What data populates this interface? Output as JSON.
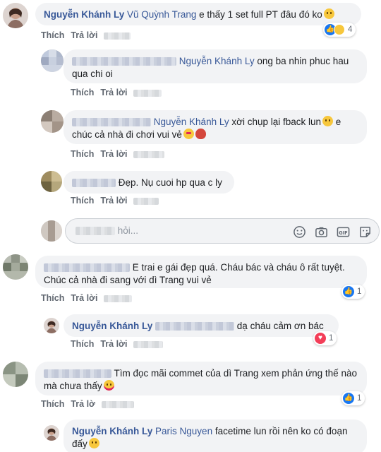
{
  "labels": {
    "like": "Thích",
    "reply": "Trả lời",
    "reply_truncated": "Trả lờ"
  },
  "colors": {
    "name": "#385898",
    "bubble": "#f2f3f5",
    "action": "#606770",
    "like_blue": "#1877f2",
    "love_red": "#f33e58"
  },
  "comments": [
    {
      "author": "Nguyễn Khánh Ly",
      "mention": "Vũ Quỳnh Trang",
      "text": "e thấy 1 set full PT đâu đó ko",
      "emoji": "laughing-tears-icon",
      "reactions": [
        "like",
        "haha"
      ],
      "reaction_count": "4"
    },
    {
      "mention": "Nguyễn Khánh Ly",
      "text": "ong ba nhin phuc hau qua chi oi"
    },
    {
      "mention": "Nguyễn Khánh Ly",
      "text_a": "xời chụp lại fback lun",
      "text_b": "e chúc cả nhà đi chơi vui vẻ",
      "emoji": [
        "laughing-tears-icon",
        "heart-eyes-icon",
        "peach-icon"
      ]
    },
    {
      "text": "Đẹp. Nụ cuoi hp qua c ly"
    },
    {
      "text": "E trai e gái đẹp quá. Cháu bác và cháu ô rất tuyệt. Chúc cả nhà đi sang với dì Trang vui vẻ",
      "reaction_count": "1"
    },
    {
      "author": "Nguyễn Khánh Ly",
      "text": "dạ cháu cảm ơn bác",
      "reaction_count": "1"
    },
    {
      "text": "Tìm đọc mãi commet của dì Trang xem phản ứng thế nào mà chưa thấy",
      "emoji": "party-face-icon",
      "reaction_count": "1"
    },
    {
      "author": "Nguyễn Khánh Ly",
      "mention": "Paris Nguyen",
      "text": "facetime lun rồi nên ko có đoạn đấy",
      "emoji": "laughing-tears-icon"
    }
  ],
  "reply_box": {
    "placeholder": "hỏi...",
    "icons": [
      "smiley-icon",
      "camera-icon",
      "gif-icon",
      "sticker-icon"
    ]
  }
}
